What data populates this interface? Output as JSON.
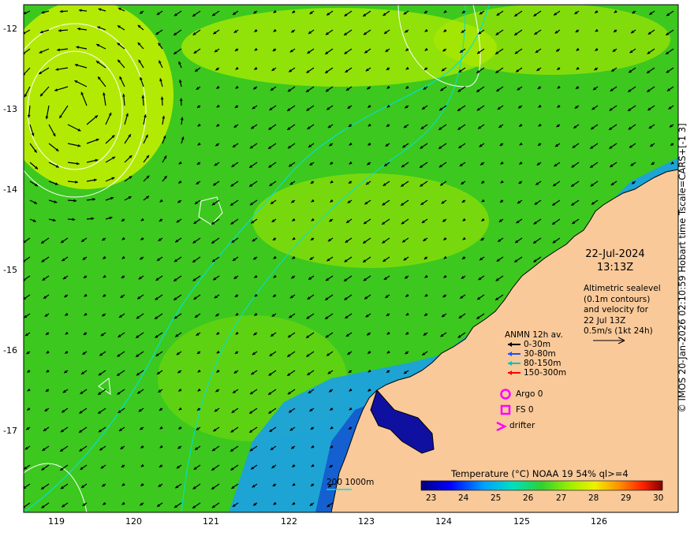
{
  "map": {
    "lat_ticks": [
      "-12",
      "-13",
      "-14",
      "-15",
      "-16",
      "-17"
    ],
    "lon_ticks": [
      "119",
      "120",
      "121",
      "122",
      "123",
      "124",
      "125",
      "126"
    ],
    "date_line1": "22-Jul-2024",
    "date_line2": "13:13Z",
    "altimetry_text": "Altimetric sealevel\n(0.1m contours)\nand velocity for\n22 Jul 13Z\n0.5m/s (1kt 24h)",
    "copyright": "© IMOS 20-Jan-2026 02:10:59 Hobart time Tscale=CARS+[-1 3]",
    "depth_legend": "200  1000m"
  },
  "anmn_legend": {
    "title": "ANMN 12h av.",
    "items": [
      {
        "label": "0-30m",
        "color": "#000000"
      },
      {
        "label": "30-80m",
        "color": "#2050ff"
      },
      {
        "label": "80-150m",
        "color": "#00c0c0"
      },
      {
        "label": "150-300m",
        "color": "#ff0000"
      }
    ]
  },
  "symbols": {
    "argo": "Argo 0",
    "fs": "FS 0",
    "drifter": "drifter",
    "symbol_color": "#ff00ff"
  },
  "colorbar": {
    "title": "Temperature (°C) NOAA 19 54% ql>=4",
    "ticks": [
      "23",
      "24",
      "25",
      "26",
      "27",
      "28",
      "29",
      "30"
    ]
  },
  "colors": {
    "land": "#f9c999",
    "ocean_base": "#3cc81e",
    "warm_patch": "#c8f000",
    "cool_water": "#1aa0e8",
    "deep_cool": "#1010a0",
    "isobath": "#00e0e0",
    "sealevel_contour": "#ffffff"
  }
}
